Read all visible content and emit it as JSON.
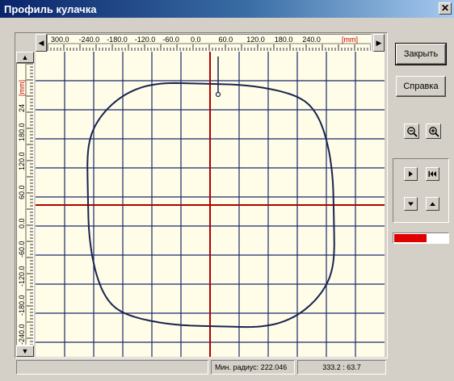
{
  "window": {
    "title": "Профиль кулачка",
    "close_glyph": "✕"
  },
  "hruler": {
    "ticks": [
      "300.0",
      "-240.0",
      "-180.0",
      "-120.0",
      "-60.0",
      "0.0",
      "60.0",
      "120.0",
      "180.0",
      "240.0"
    ],
    "unit": "[mm]"
  },
  "vruler": {
    "ticks": [
      "24",
      "180.0",
      "120.0",
      "60.0",
      "0.0",
      "-60.0",
      "-120.0",
      "-180.0",
      "-240.0"
    ],
    "unit": "[mm]"
  },
  "buttons": {
    "close": "Закрыть",
    "help": "Справка"
  },
  "icons": {
    "zoom_out": "zoom-out-icon",
    "zoom_in": "zoom-in-icon",
    "play": "play-icon",
    "rewind": "rewind-icon",
    "down": "arrow-down-icon",
    "up": "arrow-up-icon"
  },
  "progress": {
    "value": 0.6,
    "color": "#e00000"
  },
  "status": {
    "left": "",
    "min_radius": "Мин. радиус: 222.046",
    "coords": "333.2 : 63.7"
  },
  "colors": {
    "grid": "#1a2a6c",
    "axes": "#b00000",
    "profile": "#1a2450",
    "background": "#fffce8"
  }
}
